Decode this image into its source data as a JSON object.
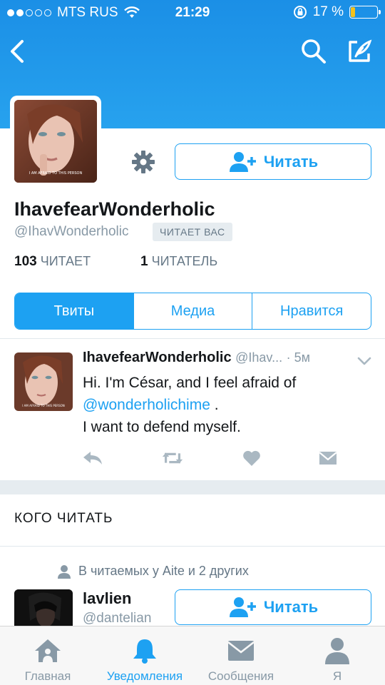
{
  "status_bar": {
    "carrier": "MTS RUS",
    "time": "21:29",
    "battery_percent": "17 %",
    "battery_level": 0.17
  },
  "header": {
    "back_icon": "chevron-left-icon",
    "search_icon": "search-icon",
    "compose_icon": "compose-tweet-icon"
  },
  "profile": {
    "display_name": "IhavefearWonderholic",
    "handle": "@IhavWonderholic",
    "follows_you_badge": "ЧИТАЕТ ВАС",
    "following_count": "103",
    "following_label": "ЧИТАЕТ",
    "followers_count": "1",
    "followers_label": "ЧИТАТЕЛЬ",
    "follow_button_label": "Читать",
    "avatar_caption": "I AM AFRAID TO THIS PERSON"
  },
  "tabs": [
    {
      "label": "Твиты",
      "active": true
    },
    {
      "label": "Медиа",
      "active": false
    },
    {
      "label": "Нравится",
      "active": false
    }
  ],
  "tweet": {
    "author_name": "IhavefearWonderholic",
    "author_handle": "@Ihav...",
    "time": "· 5м",
    "text_line1": "Hi. I'm César, and I feel afraid of",
    "mention": "@wonderholichime",
    "text_after_mention": " .",
    "text_line3": "I want to defend myself.",
    "avatar_caption": "I AM AFRAID TO THIS PERSON"
  },
  "who_to_follow": {
    "title": "КОГО ЧИТАТЬ",
    "context": "В читаемых у Aite и 2 других",
    "suggestion_name": "lavlien",
    "suggestion_handle": "@dantelian",
    "follow_button_label": "Читать"
  },
  "tab_bar": {
    "items": [
      {
        "label": "Главная",
        "icon": "home-icon",
        "active": false
      },
      {
        "label": "Уведомления",
        "icon": "bell-icon",
        "active": true
      },
      {
        "label": "Сообщения",
        "icon": "envelope-icon",
        "active": false
      },
      {
        "label": "Я",
        "icon": "person-icon",
        "active": false
      }
    ]
  },
  "colors": {
    "accent": "#1da1f2",
    "header_top": "#1b8fe6",
    "battery": "#f5c21b",
    "muted": "#8899a6"
  }
}
